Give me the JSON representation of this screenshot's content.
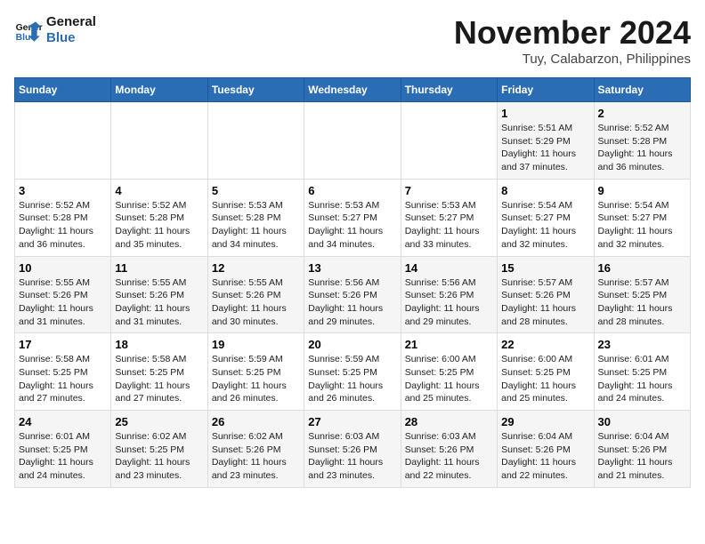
{
  "header": {
    "logo_line1": "General",
    "logo_line2": "Blue",
    "month": "November 2024",
    "location": "Tuy, Calabarzon, Philippines"
  },
  "weekdays": [
    "Sunday",
    "Monday",
    "Tuesday",
    "Wednesday",
    "Thursday",
    "Friday",
    "Saturday"
  ],
  "weeks": [
    [
      null,
      null,
      null,
      null,
      null,
      {
        "day": "1",
        "sunrise": "5:51 AM",
        "sunset": "5:29 PM",
        "daylight": "11 hours and 37 minutes."
      },
      {
        "day": "2",
        "sunrise": "5:52 AM",
        "sunset": "5:28 PM",
        "daylight": "11 hours and 36 minutes."
      }
    ],
    [
      {
        "day": "3",
        "sunrise": "5:52 AM",
        "sunset": "5:28 PM",
        "daylight": "11 hours and 36 minutes."
      },
      {
        "day": "4",
        "sunrise": "5:52 AM",
        "sunset": "5:28 PM",
        "daylight": "11 hours and 35 minutes."
      },
      {
        "day": "5",
        "sunrise": "5:53 AM",
        "sunset": "5:28 PM",
        "daylight": "11 hours and 34 minutes."
      },
      {
        "day": "6",
        "sunrise": "5:53 AM",
        "sunset": "5:27 PM",
        "daylight": "11 hours and 34 minutes."
      },
      {
        "day": "7",
        "sunrise": "5:53 AM",
        "sunset": "5:27 PM",
        "daylight": "11 hours and 33 minutes."
      },
      {
        "day": "8",
        "sunrise": "5:54 AM",
        "sunset": "5:27 PM",
        "daylight": "11 hours and 32 minutes."
      },
      {
        "day": "9",
        "sunrise": "5:54 AM",
        "sunset": "5:27 PM",
        "daylight": "11 hours and 32 minutes."
      }
    ],
    [
      {
        "day": "10",
        "sunrise": "5:55 AM",
        "sunset": "5:26 PM",
        "daylight": "11 hours and 31 minutes."
      },
      {
        "day": "11",
        "sunrise": "5:55 AM",
        "sunset": "5:26 PM",
        "daylight": "11 hours and 31 minutes."
      },
      {
        "day": "12",
        "sunrise": "5:55 AM",
        "sunset": "5:26 PM",
        "daylight": "11 hours and 30 minutes."
      },
      {
        "day": "13",
        "sunrise": "5:56 AM",
        "sunset": "5:26 PM",
        "daylight": "11 hours and 29 minutes."
      },
      {
        "day": "14",
        "sunrise": "5:56 AM",
        "sunset": "5:26 PM",
        "daylight": "11 hours and 29 minutes."
      },
      {
        "day": "15",
        "sunrise": "5:57 AM",
        "sunset": "5:26 PM",
        "daylight": "11 hours and 28 minutes."
      },
      {
        "day": "16",
        "sunrise": "5:57 AM",
        "sunset": "5:25 PM",
        "daylight": "11 hours and 28 minutes."
      }
    ],
    [
      {
        "day": "17",
        "sunrise": "5:58 AM",
        "sunset": "5:25 PM",
        "daylight": "11 hours and 27 minutes."
      },
      {
        "day": "18",
        "sunrise": "5:58 AM",
        "sunset": "5:25 PM",
        "daylight": "11 hours and 27 minutes."
      },
      {
        "day": "19",
        "sunrise": "5:59 AM",
        "sunset": "5:25 PM",
        "daylight": "11 hours and 26 minutes."
      },
      {
        "day": "20",
        "sunrise": "5:59 AM",
        "sunset": "5:25 PM",
        "daylight": "11 hours and 26 minutes."
      },
      {
        "day": "21",
        "sunrise": "6:00 AM",
        "sunset": "5:25 PM",
        "daylight": "11 hours and 25 minutes."
      },
      {
        "day": "22",
        "sunrise": "6:00 AM",
        "sunset": "5:25 PM",
        "daylight": "11 hours and 25 minutes."
      },
      {
        "day": "23",
        "sunrise": "6:01 AM",
        "sunset": "5:25 PM",
        "daylight": "11 hours and 24 minutes."
      }
    ],
    [
      {
        "day": "24",
        "sunrise": "6:01 AM",
        "sunset": "5:25 PM",
        "daylight": "11 hours and 24 minutes."
      },
      {
        "day": "25",
        "sunrise": "6:02 AM",
        "sunset": "5:25 PM",
        "daylight": "11 hours and 23 minutes."
      },
      {
        "day": "26",
        "sunrise": "6:02 AM",
        "sunset": "5:26 PM",
        "daylight": "11 hours and 23 minutes."
      },
      {
        "day": "27",
        "sunrise": "6:03 AM",
        "sunset": "5:26 PM",
        "daylight": "11 hours and 23 minutes."
      },
      {
        "day": "28",
        "sunrise": "6:03 AM",
        "sunset": "5:26 PM",
        "daylight": "11 hours and 22 minutes."
      },
      {
        "day": "29",
        "sunrise": "6:04 AM",
        "sunset": "5:26 PM",
        "daylight": "11 hours and 22 minutes."
      },
      {
        "day": "30",
        "sunrise": "6:04 AM",
        "sunset": "5:26 PM",
        "daylight": "11 hours and 21 minutes."
      }
    ]
  ],
  "labels": {
    "sunrise": "Sunrise: ",
    "sunset": "Sunset: ",
    "daylight": "Daylight: "
  }
}
